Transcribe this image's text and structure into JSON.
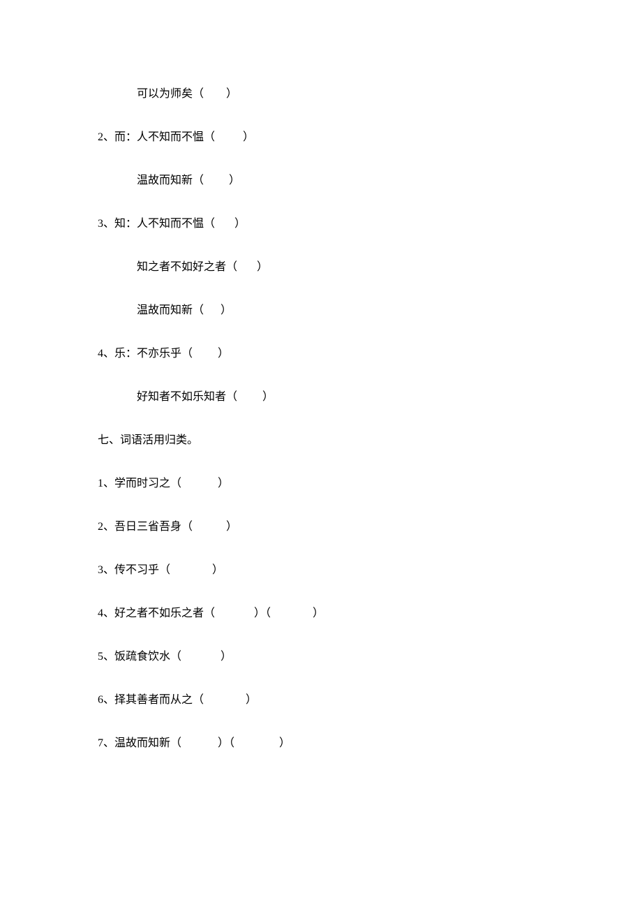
{
  "lines": [
    {
      "class": "indent",
      "text": "可以为师矣（        ）"
    },
    {
      "class": "",
      "text": "2、而：人不知而不愠（          ）"
    },
    {
      "class": "indent",
      "text": "温故而知新（         ）"
    },
    {
      "class": "",
      "text": "3、知：人不知而不愠（       ）"
    },
    {
      "class": "indent",
      "text": "知之者不如好之者（       ）"
    },
    {
      "class": "indent",
      "text": "温故而知新（      ）"
    },
    {
      "class": "",
      "text": "4、乐：不亦乐乎（         ）"
    },
    {
      "class": "indent",
      "text": "好知者不如乐知者（         ）"
    },
    {
      "class": "",
      "text": "七、词语活用归类。"
    },
    {
      "class": "",
      "text": "1、学而时习之（             ）"
    },
    {
      "class": "",
      "text": "2、吾日三省吾身（            ）"
    },
    {
      "class": "",
      "text": "3、传不习乎（               ）"
    },
    {
      "class": "",
      "text": "4、好之者不如乐之者（              ）（               ）"
    },
    {
      "class": "",
      "text": "5、饭疏食饮水（              ）"
    },
    {
      "class": "",
      "text": "6、择其善者而从之（               ）"
    },
    {
      "class": "",
      "text": "7、温故而知新（             ）（                ）"
    }
  ]
}
